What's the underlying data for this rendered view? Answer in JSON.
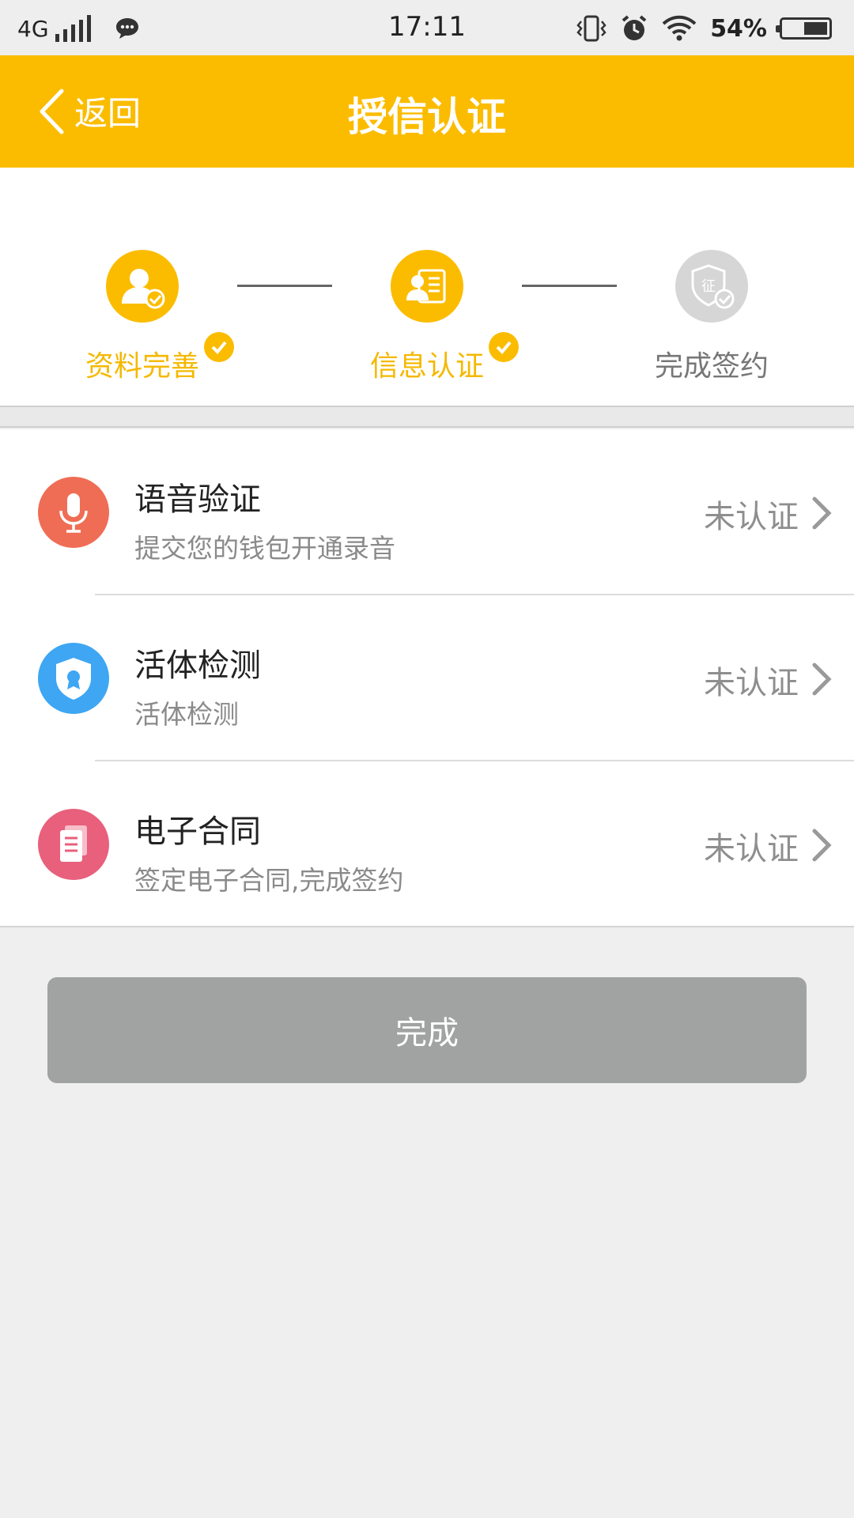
{
  "status_bar": {
    "network": "4G",
    "time": "17:11",
    "battery": "54%",
    "battery_level": 0.54,
    "icons": [
      "signal-icon",
      "message-icon",
      "vibrate-icon",
      "alarm-icon",
      "wifi-icon",
      "battery-icon"
    ]
  },
  "header": {
    "back_label": "返回",
    "title": "授信认证",
    "background": "#fbbc00"
  },
  "steps": [
    {
      "label": "资料完善",
      "completed": true,
      "icon": "user-check-icon",
      "color": "#fbbc00"
    },
    {
      "label": "信息认证",
      "completed": true,
      "icon": "id-card-icon",
      "color": "#fbbc00"
    },
    {
      "label": "完成签约",
      "completed": false,
      "icon": "shield-seal-icon",
      "color": "#d6d6d6"
    }
  ],
  "items": [
    {
      "title": "语音验证",
      "subtitle": "提交您的钱包开通录音",
      "status": "未认证",
      "icon": "microphone-icon",
      "icon_color": "#ef6d55"
    },
    {
      "title": "活体检测",
      "subtitle": "活体检测",
      "status": "未认证",
      "icon": "shield-badge-icon",
      "icon_color": "#3ea6f3"
    },
    {
      "title": "电子合同",
      "subtitle": "签定电子合同,完成签约",
      "status": "未认证",
      "icon": "document-icon",
      "icon_color": "#e8607c"
    }
  ],
  "done_button": {
    "label": "完成",
    "background": "#a1a3a3"
  }
}
